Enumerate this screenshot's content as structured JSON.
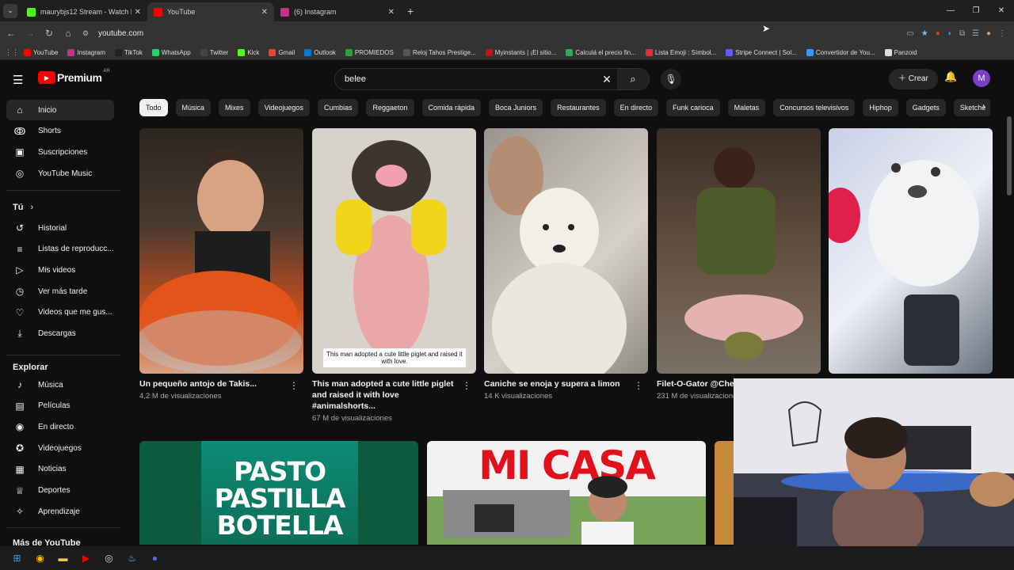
{
  "tabs": [
    {
      "label": "maurybjs12 Stream - Watch Liv",
      "color": "#53fc18"
    },
    {
      "label": "YouTube",
      "color": "#ff0000"
    },
    {
      "label": "(6) Instagram",
      "color": "#c13584"
    }
  ],
  "address": {
    "url": "youtube.com"
  },
  "bookmarks": [
    {
      "label": "YouTube",
      "color": "#ff0000"
    },
    {
      "label": "Instagram",
      "color": "#c13584"
    },
    {
      "label": "TikTok",
      "color": "#222222"
    },
    {
      "label": "WhatsApp",
      "color": "#25d366"
    },
    {
      "label": "Twitter",
      "color": "#444444"
    },
    {
      "label": "Kick",
      "color": "#53fc18"
    },
    {
      "label": "Gmail",
      "color": "#ea4335"
    },
    {
      "label": "Outlook",
      "color": "#0078d4"
    },
    {
      "label": "PROMIEDOS",
      "color": "#2e9e3e"
    },
    {
      "label": "Reloj Tahos Prestige...",
      "color": "#555555"
    },
    {
      "label": "Myinstants | ¡El sitio...",
      "color": "#cc1111"
    },
    {
      "label": "Calculá el precio fin...",
      "color": "#2eaa55"
    },
    {
      "label": "Lista Emoji : Símbol...",
      "color": "#e03030"
    },
    {
      "label": "Stripe Connect | Sol...",
      "color": "#635bff"
    },
    {
      "label": "Convertidor de You...",
      "color": "#3399ff"
    },
    {
      "label": "Panzoid",
      "color": "#dddddd"
    }
  ],
  "header": {
    "logo": "Premium",
    "country": "AR",
    "search_value": "belee",
    "create_label": "Crear",
    "avatar_letter": "M"
  },
  "sidebar": {
    "main": [
      {
        "label": "Inicio",
        "icon": "home-icon",
        "glyph": "⌂"
      },
      {
        "label": "Shorts",
        "icon": "shorts-icon",
        "glyph": "ↂ"
      },
      {
        "label": "Suscripciones",
        "icon": "subscriptions-icon",
        "glyph": "▣"
      },
      {
        "label": "YouTube Music",
        "icon": "music-icon",
        "glyph": "◎"
      }
    ],
    "you_heading": "Tú",
    "you": [
      {
        "label": "Historial",
        "icon": "history-icon",
        "glyph": "↺"
      },
      {
        "label": "Listas de reproducc...",
        "icon": "playlists-icon",
        "glyph": "≡"
      },
      {
        "label": "Mis videos",
        "icon": "my-videos-icon",
        "glyph": "▷"
      },
      {
        "label": "Ver más tarde",
        "icon": "watch-later-icon",
        "glyph": "◷"
      },
      {
        "label": "Videos que me gus...",
        "icon": "liked-icon",
        "glyph": "♡"
      },
      {
        "label": "Descargas",
        "icon": "downloads-icon",
        "glyph": "⤓"
      }
    ],
    "explore_heading": "Explorar",
    "explore": [
      {
        "label": "Música",
        "icon": "music-note-icon",
        "glyph": "♪"
      },
      {
        "label": "Películas",
        "icon": "movies-icon",
        "glyph": "▤"
      },
      {
        "label": "En directo",
        "icon": "live-icon",
        "glyph": "◉"
      },
      {
        "label": "Videojuegos",
        "icon": "gaming-icon",
        "glyph": "✪"
      },
      {
        "label": "Noticias",
        "icon": "news-icon",
        "glyph": "▦"
      },
      {
        "label": "Deportes",
        "icon": "sports-icon",
        "glyph": "♕"
      },
      {
        "label": "Aprendizaje",
        "icon": "learning-icon",
        "glyph": "✧"
      }
    ],
    "more_heading": "Más de YouTube"
  },
  "chips": [
    "Todo",
    "Música",
    "Mixes",
    "Videojuegos",
    "Cumbias",
    "Reggaeton",
    "Comida rápida",
    "Boca Juniors",
    "Restaurantes",
    "En directo",
    "Funk carioca",
    "Maletas",
    "Concursos televisivos",
    "Hiphop",
    "Gadgets",
    "Sketche"
  ],
  "videos": [
    {
      "title": "Un pequeño antojo de Takis...",
      "meta": "4,2 M de visualizaciones",
      "thumb_color": "#3a2a22",
      "accent": "#e8581b"
    },
    {
      "title": "This man adopted a cute little piglet and raised it with love #animalshorts...",
      "meta": "67 M de visualizaciones",
      "caption": "This man adopted a cute little piglet and raised it with love.",
      "thumb_color": "#d9d4cc",
      "accent": "#f1d21a"
    },
    {
      "title": "Caniche se enoja y supera a limon",
      "meta": "14 K visualizaciones",
      "thumb_color": "#b8b3ac",
      "accent": "#f2efe8"
    },
    {
      "title": "Filet-O-Gator @Chef Foods",
      "meta": "231 M de visualizacione",
      "thumb_color": "#5a4636",
      "accent": "#e6b7b2"
    },
    {
      "title": "",
      "meta": "",
      "thumb_color": "#9aa7c6",
      "accent": "#ffffff"
    }
  ],
  "row2": [
    {
      "text_lines": [
        "PASTO",
        "PASTILLA",
        "BOTELLA"
      ],
      "bg": "#0e5a3f"
    },
    {
      "text": "MI CASA",
      "bg": "#f2f2f2"
    }
  ]
}
